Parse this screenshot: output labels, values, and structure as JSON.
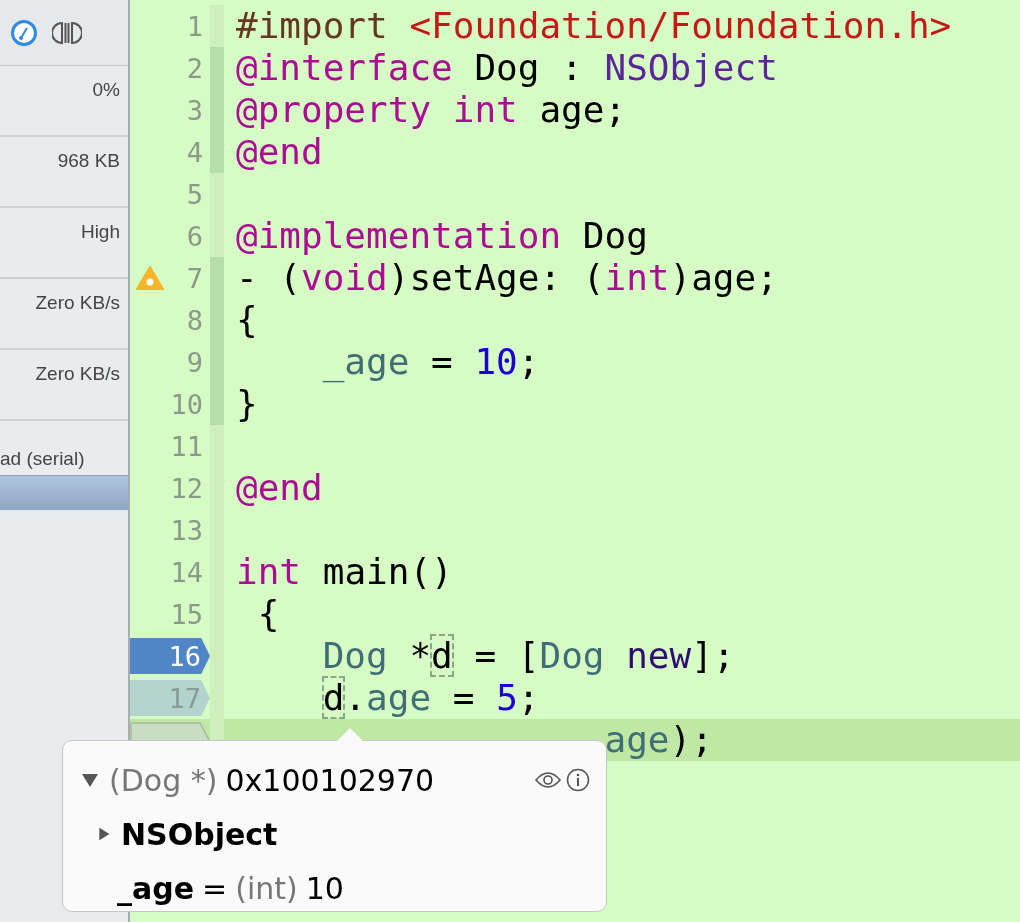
{
  "sidebar": {
    "rows": [
      {
        "value": "0%"
      },
      {
        "value": "968 KB"
      },
      {
        "value": "High"
      },
      {
        "value": "Zero KB/s"
      },
      {
        "value": "Zero KB/s"
      },
      {
        "value": "ad (serial)"
      }
    ]
  },
  "editor": {
    "lines": [
      {
        "number": "1",
        "kind": "plain",
        "fold": false,
        "highlighted": false,
        "tokens": [
          {
            "text": "#import ",
            "kind": "preprocessor"
          },
          {
            "text": "<Foundation/Foundation.h>",
            "kind": "string"
          }
        ]
      },
      {
        "number": "2",
        "kind": "plain",
        "fold": true,
        "highlighted": false,
        "tokens": [
          {
            "text": "@interface",
            "kind": "keyword"
          },
          {
            "text": " Dog : ",
            "kind": "plain"
          },
          {
            "text": "NSObject",
            "kind": "class"
          }
        ]
      },
      {
        "number": "3",
        "kind": "plain",
        "fold": true,
        "highlighted": false,
        "tokens": [
          {
            "text": "@property int",
            "kind": "keyword"
          },
          {
            "text": " age;",
            "kind": "plain"
          }
        ]
      },
      {
        "number": "4",
        "kind": "plain",
        "fold": true,
        "highlighted": false,
        "tokens": [
          {
            "text": "@end",
            "kind": "keyword"
          }
        ]
      },
      {
        "number": "5",
        "kind": "plain",
        "fold": false,
        "highlighted": false
      },
      {
        "number": "6",
        "kind": "plain",
        "fold": false,
        "highlighted": false,
        "tokens": [
          {
            "text": "@implementation",
            "kind": "keyword"
          },
          {
            "text": " Dog",
            "kind": "plain"
          }
        ]
      },
      {
        "number": "7",
        "kind": "warning",
        "fold": true,
        "highlighted": false,
        "tokens": [
          {
            "text": "- (",
            "kind": "plain"
          },
          {
            "text": "void",
            "kind": "keyword"
          },
          {
            "text": ")setAge: (",
            "kind": "plain"
          },
          {
            "text": "int",
            "kind": "keyword"
          },
          {
            "text": ")age;",
            "kind": "plain"
          }
        ]
      },
      {
        "number": "8",
        "kind": "plain",
        "fold": true,
        "highlighted": false,
        "tokens": [
          {
            "text": "{",
            "kind": "plain"
          }
        ]
      },
      {
        "number": "9",
        "kind": "plain",
        "fold": true,
        "highlighted": false,
        "indented": true,
        "tokens": [
          {
            "text": "_age",
            "kind": "identifier"
          },
          {
            "text": " = ",
            "kind": "plain"
          },
          {
            "text": "10",
            "kind": "number"
          },
          {
            "text": ";",
            "kind": "plain"
          }
        ]
      },
      {
        "number": "10",
        "kind": "plain",
        "fold": true,
        "highlighted": false,
        "tokens": [
          {
            "text": "}",
            "kind": "plain"
          }
        ]
      },
      {
        "number": "11",
        "kind": "plain",
        "fold": false,
        "highlighted": false
      },
      {
        "number": "12",
        "kind": "plain",
        "fold": false,
        "highlighted": false,
        "tokens": [
          {
            "text": "@end",
            "kind": "keyword"
          }
        ]
      },
      {
        "number": "13",
        "kind": "plain",
        "fold": false,
        "highlighted": false
      },
      {
        "number": "14",
        "kind": "plain",
        "fold": false,
        "highlighted": false,
        "tokens": [
          {
            "text": "int",
            "kind": "keyword"
          },
          {
            "text": " main()",
            "kind": "plain"
          }
        ]
      },
      {
        "number": "15",
        "kind": "plain",
        "fold": false,
        "highlighted": false,
        "tokens": [
          {
            "text": " {",
            "kind": "plain"
          }
        ]
      },
      {
        "number": "16",
        "kind": "current",
        "fold": false,
        "highlighted": false,
        "indented": true,
        "tokens": [
          {
            "text": "Dog",
            "kind": "identifier"
          },
          {
            "text": " *",
            "kind": "plain"
          },
          {
            "text": "d",
            "kind": "plain",
            "outlined": true
          },
          {
            "text": " = [",
            "kind": "plain"
          },
          {
            "text": "Dog",
            "kind": "identifier"
          },
          {
            "text": " new",
            "kind": "method"
          },
          {
            "text": "];",
            "kind": "plain"
          }
        ]
      },
      {
        "number": "17",
        "kind": "thread",
        "fold": false,
        "highlighted": false,
        "indented": true,
        "tokens": [
          {
            "text": "d",
            "kind": "plain",
            "outlined": true
          },
          {
            "text": ".",
            "kind": "plain"
          },
          {
            "text": "age",
            "kind": "identifier"
          },
          {
            "text": " = ",
            "kind": "plain"
          },
          {
            "text": "5",
            "kind": "number"
          },
          {
            "text": ";",
            "kind": "plain"
          }
        ]
      },
      {
        "kind": "covered",
        "fold": false,
        "highlighted": true,
        "tokens": [
          {
            "text": "age",
            "kind": "identifier"
          },
          {
            "text": ");",
            "kind": "plain"
          }
        ]
      }
    ]
  },
  "popover": {
    "rows": [
      {
        "expanded": true,
        "type_text": "(Dog *)",
        "value": "0x100102970"
      },
      {
        "expanded": false,
        "name": "NSObject"
      },
      {
        "name": "_age",
        "equals": "=",
        "type_text": "(int)",
        "value": "10"
      }
    ]
  }
}
